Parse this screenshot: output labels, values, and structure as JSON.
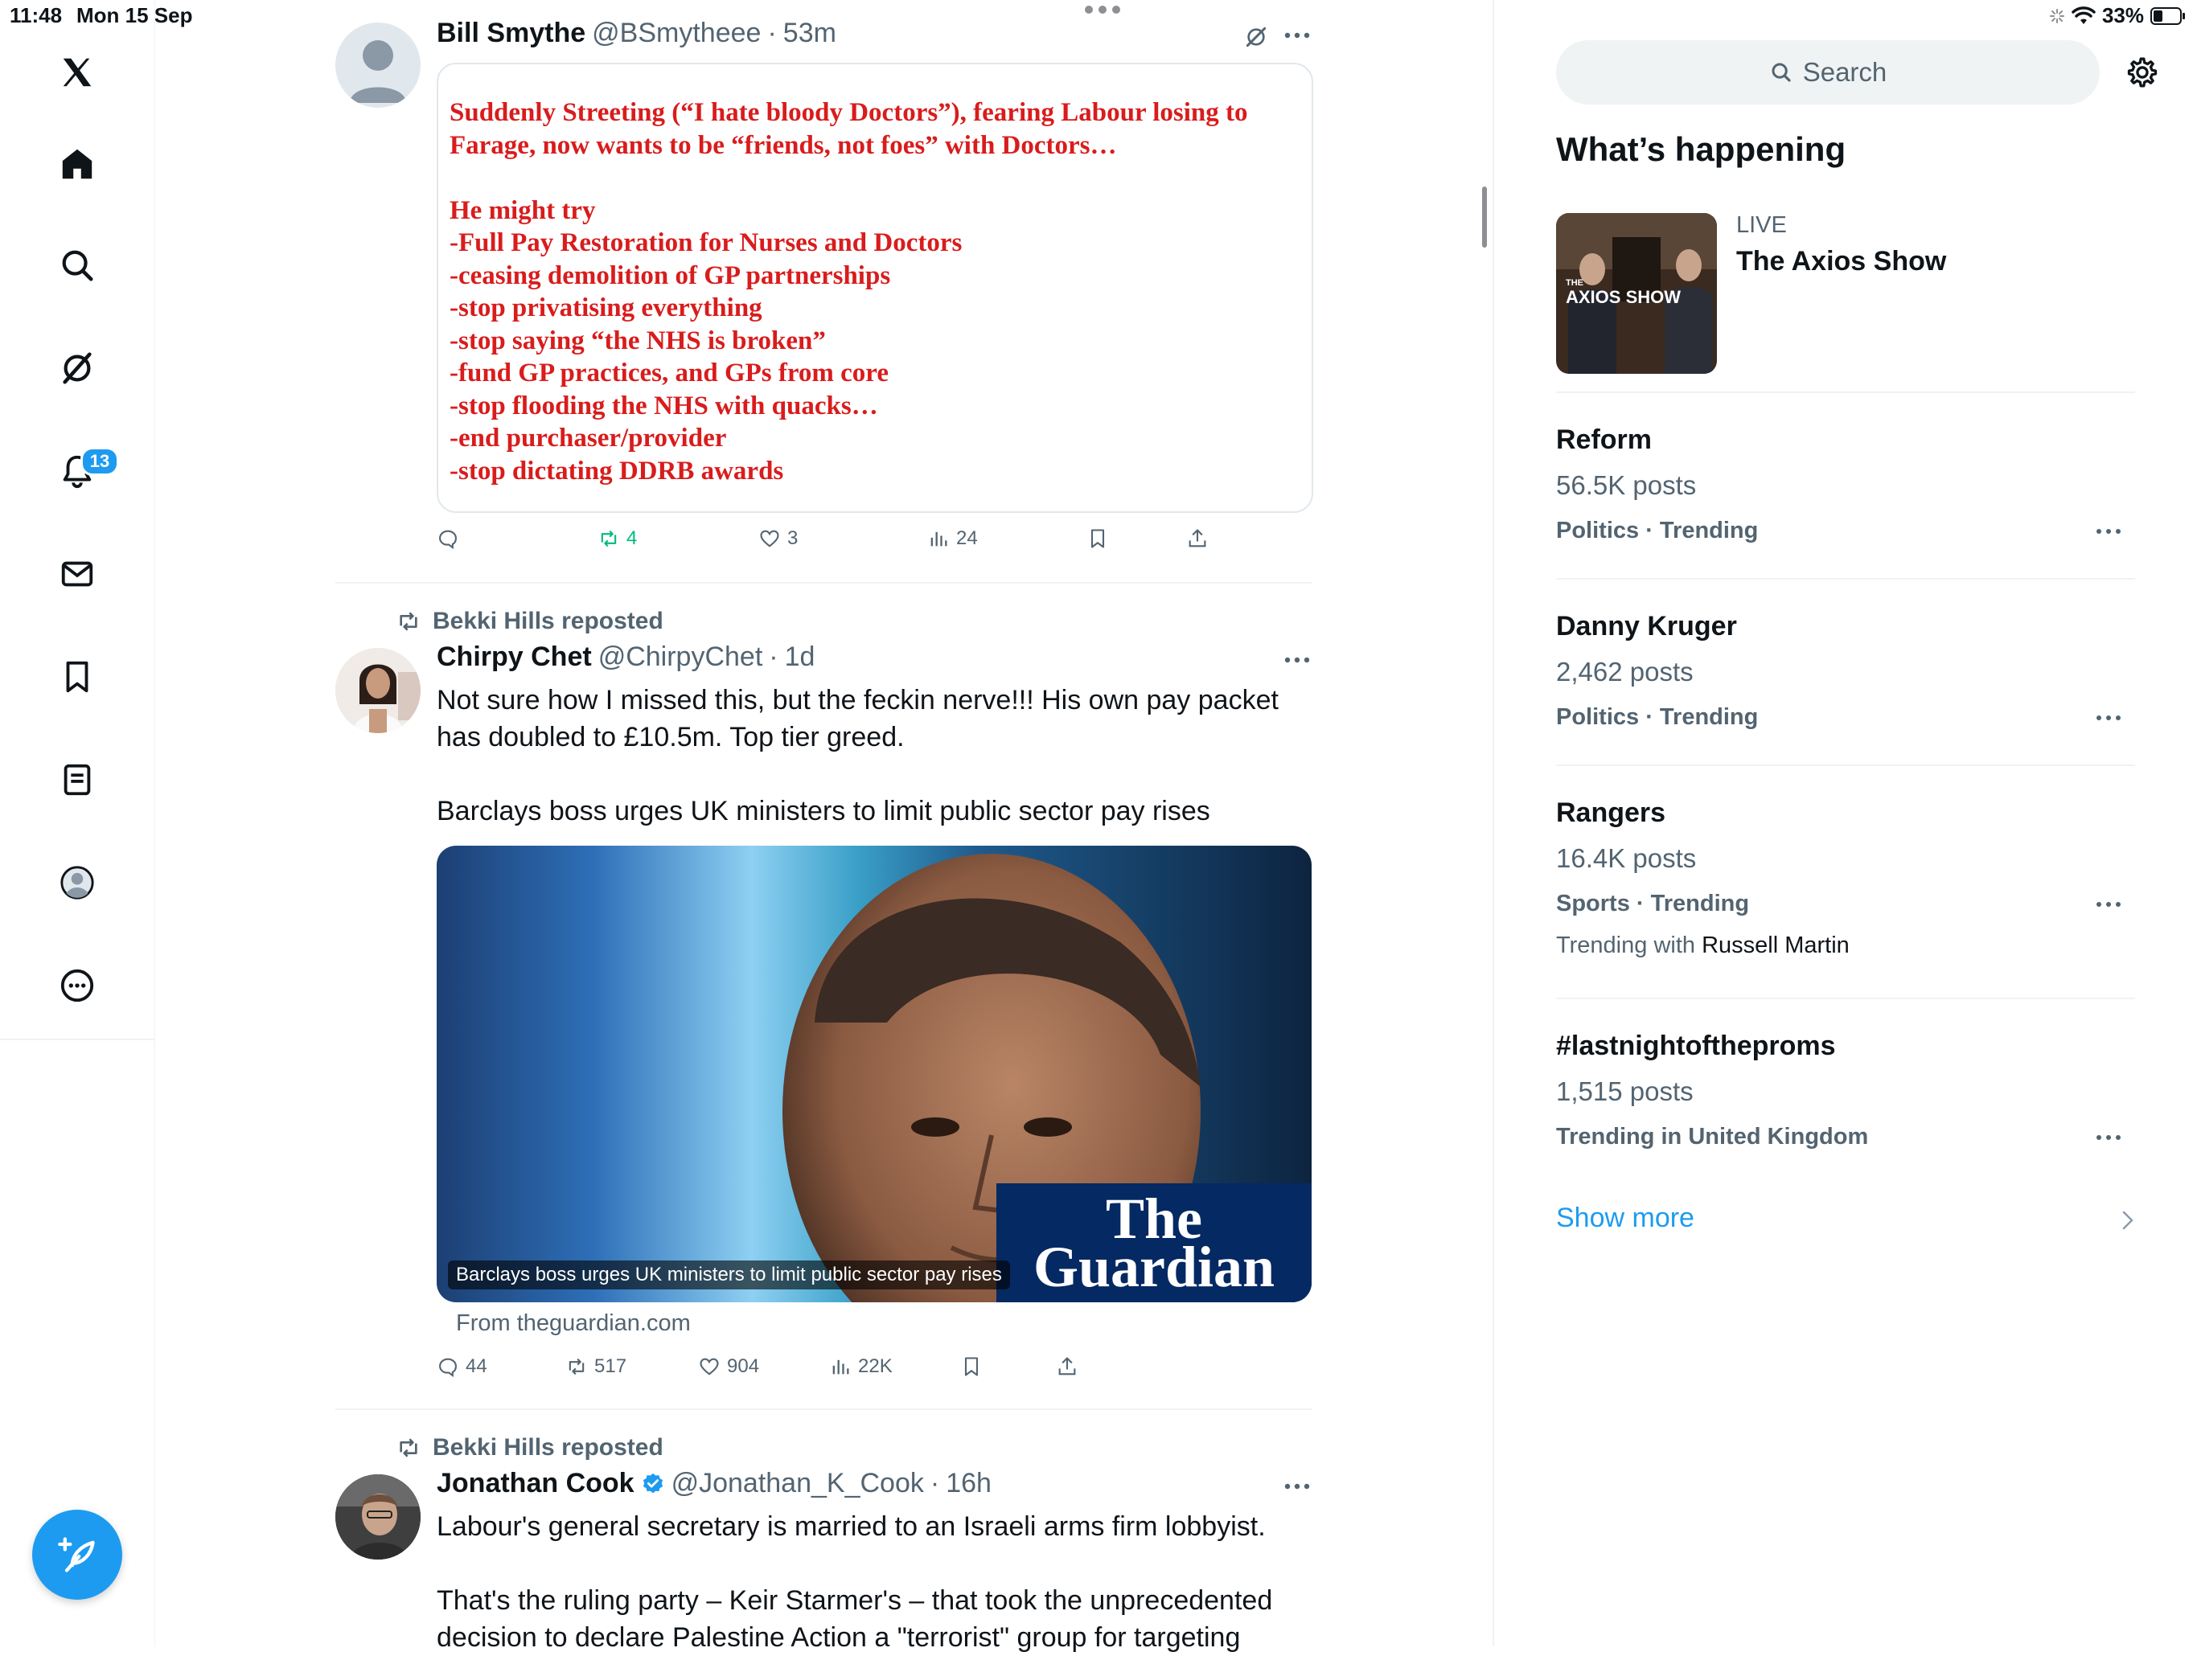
{
  "status_bar": {
    "time": "11:48",
    "date": "Mon 15 Sep",
    "battery": "33%"
  },
  "nav": {
    "items": [
      {
        "name": "logo-x-icon"
      },
      {
        "name": "home-icon"
      },
      {
        "name": "explore-search-icon"
      },
      {
        "name": "grok-icon"
      },
      {
        "name": "notifications-bell-icon"
      },
      {
        "name": "messages-envelope-icon"
      },
      {
        "name": "bookmarks-icon"
      },
      {
        "name": "lists-icon"
      },
      {
        "name": "profile-icon"
      },
      {
        "name": "more-circle-icon"
      }
    ],
    "notifications_badge": "13",
    "compose_icon": "compose-feather-plus-icon"
  },
  "tweets": [
    {
      "name": "Bill Smythe",
      "handle": "@BSmytheee",
      "time": "53m",
      "quote_text": "Suddenly Streeting (“I hate bloody Doctors”), fearing Labour losing to Farage, now wants to be “friends, not foes” with Doctors…\n\nHe might try\n-Full Pay Restoration for Nurses and Doctors\n-ceasing demolition of GP partnerships\n-stop privatising everything\n-stop saying “the NHS is broken”\n-fund GP practices, and GPs from core\n-stop flooding the NHS with quacks…\n-end purchaser/provider\n-stop dictating DDRB awards",
      "retweets": "4",
      "likes": "3",
      "views": "24",
      "accent": "#00ba7c"
    },
    {
      "repost_by": "Bekki Hills reposted",
      "name": "Chirpy Chet",
      "handle": "@ChirpyChet",
      "time": "1d",
      "text": "Not sure how I missed this, but the feckin nerve!!! His own pay packet has doubled to £10.5m. Top tier greed.\n\nBarclays boss urges UK ministers to limit public sector pay rises",
      "card_caption": "Barclays boss urges UK ministers to limit public sector pay rises",
      "card_brand": "The Guardian",
      "card_source": "From theguardian.com",
      "replies": "44",
      "retweets": "517",
      "likes": "904",
      "views": "22K"
    },
    {
      "repost_by": "Bekki Hills reposted",
      "name": "Jonathan Cook",
      "handle": "@Jonathan_K_Cook",
      "time": "16h",
      "text": "Labour's general secretary is married to an Israeli arms firm lobbyist.\n\nThat's the ruling party – Keir Starmer's – that took the unprecedented decision to declare Palestine Action a \"terrorist\" group for targeting"
    }
  ],
  "sidebar": {
    "search_placeholder": "Search",
    "section_title": "What’s happening",
    "live": {
      "label": "LIVE",
      "title": "The Axios Show",
      "thumb_text": "AXIOS SHOW",
      "thumb_small": "THE"
    },
    "trends": [
      {
        "name": "Reform",
        "count": "56.5K posts",
        "category": "Politics · Trending"
      },
      {
        "name": "Danny Kruger",
        "count": "2,462 posts",
        "category": "Politics · Trending"
      },
      {
        "name": "Rangers",
        "count": "16.4K posts",
        "category": "Sports · Trending",
        "extra_prefix": "Trending with",
        "extra_name": "Russell Martin"
      },
      {
        "name": "#lastnightoftheproms",
        "count": "1,515 posts",
        "category": "Trending in United Kingdom"
      }
    ],
    "show_more": "Show more"
  },
  "colors": {
    "accent": "#1d9bf0",
    "text": "#0f1419",
    "muted": "#536471",
    "quote_red": "#d91c1c",
    "guardian_blue": "#052962"
  }
}
